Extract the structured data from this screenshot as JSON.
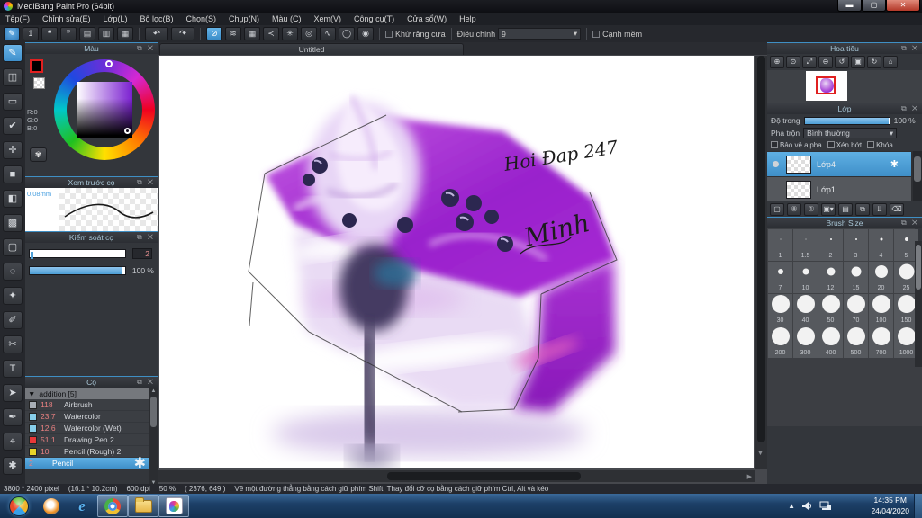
{
  "window": {
    "title": "MediBang Paint Pro (64bit)",
    "controls": [
      "minimize-icon",
      "maximize-icon",
      "close-icon"
    ]
  },
  "menubar": {
    "items": [
      "Tệp(F)",
      "Chỉnh sửa(E)",
      "Lớp(L)",
      "Bộ lọc(B)",
      "Chọn(S)",
      "Chụp(N)",
      "Màu (C)",
      "Xem(V)",
      "Công cụ(T)",
      "Cửa sổ(W)",
      "Help"
    ]
  },
  "toolbar": {
    "icons": [
      "paint-circle-icon",
      "export-icon",
      "comment-icon",
      "comment-panel-icon",
      "file-icon",
      "file-list-icon",
      "grid-icon",
      "undo-icon",
      "redo-icon",
      "snap-off-icon",
      "snap-parallel-icon",
      "snap-grid-icon",
      "snap-vanishing-icon",
      "snap-radial-icon",
      "snap-concentric-icon",
      "snap-curve-icon",
      "snap-ellipse-icon",
      "snap-spiral-icon"
    ],
    "antialias_label": "Khử răng cưa",
    "correction_label": "Điều chỉnh",
    "correction_value": "9",
    "soft_edge_label": "Cạnh mềm"
  },
  "tools": {
    "names": [
      "brush",
      "eraser",
      "frame",
      "snap-check",
      "move",
      "fill-rect",
      "bucket",
      "gradient",
      "select-rect",
      "lasso",
      "magic-wand",
      "select-pen",
      "select-eraser",
      "text",
      "operate",
      "pen",
      "eyedropper",
      "hand"
    ],
    "selected": "brush"
  },
  "panels": {
    "color": {
      "title": "Màu",
      "r": "R:0",
      "g": "G:0",
      "b": "B:0",
      "accent": "#7a1fd0"
    },
    "preview": {
      "title": "Xem trước cọ",
      "size_label": "0.08mm"
    },
    "control": {
      "title": "Kiểm soát cọ",
      "value": "2",
      "percent": "100 %"
    },
    "brushes": {
      "title": "Cọ",
      "group": "addition [5]",
      "items": [
        {
          "num": "118",
          "name": "Airbrush",
          "color": "#a8aeb6"
        },
        {
          "num": "23.7",
          "name": "Watercolor",
          "color": "#86ceea"
        },
        {
          "num": "12.6",
          "name": "Watercolor (Wet)",
          "color": "#86ceea"
        },
        {
          "num": "51.1",
          "name": "Drawing Pen 2",
          "color": "#e83838"
        },
        {
          "num": "10",
          "name": "Pencil (Rough) 2",
          "color": "#e8d428"
        }
      ],
      "selected": {
        "num": "2",
        "name": "Pencil"
      },
      "footer_icons": [
        "cloud-upload-icon",
        "new-brush-icon",
        "brush-menu-icon",
        "script-brush-icon",
        "folder-icon",
        "duplicate-icon",
        "trash-icon"
      ]
    },
    "navigator": {
      "title": "Hoa tiêu",
      "icons": [
        "zoom-in-icon",
        "zoom-icon",
        "fit-screen-icon",
        "zoom-out-icon",
        "rotate-left-icon",
        "frame-icon",
        "rotate-reset-icon",
        "lock-icon"
      ]
    },
    "layers": {
      "title": "Lớp",
      "opacity_label": "Độ trong",
      "opacity_value": "100 %",
      "blend_label": "Pha trộn",
      "blend_value": "Bình thường",
      "checkboxes": [
        "Bảo vệ alpha",
        "Xén bớt",
        "Khóa"
      ],
      "items": [
        {
          "name": "Lớp4",
          "selected": true
        },
        {
          "name": "Lớp1",
          "selected": false
        }
      ],
      "footer_icons": [
        "new-layer-icon",
        "new-8bit-layer-icon",
        "new-1bit-layer-icon",
        "add-menu-icon",
        "folder-icon",
        "duplicate-icon",
        "merge-icon",
        "trash-icon"
      ]
    },
    "brush_size": {
      "title": "Brush Size",
      "sizes": [
        "1",
        "1.5",
        "2",
        "3",
        "4",
        "5",
        "7",
        "10",
        "12",
        "15",
        "20",
        "25",
        "30",
        "40",
        "50",
        "70",
        "100",
        "150",
        "200",
        "300",
        "400",
        "500",
        "700",
        "1000"
      ]
    }
  },
  "canvas": {
    "tab": "Untitled",
    "annotation": "Hoi Đap 247",
    "signature": "Minh"
  },
  "statusbar": {
    "dimensions": "3800 * 2400 pixel",
    "size_cm": "(16.1 * 10.2cm)",
    "dpi": "600 dpi",
    "zoom": "50 %",
    "coords": "( 2376, 649 )",
    "hint": "Vẽ một đường thẳng bằng cách giữ phím Shift, Thay đổi cỡ cọ bằng cách giữ phím Ctrl, Alt và kéo"
  },
  "taskbar": {
    "icons": [
      "start-orb-icon",
      "media-player-icon",
      "internet-explorer-icon",
      "chrome-icon",
      "explorer-icon",
      "medibang-icon"
    ],
    "tray_icons": [
      "tray-expand-icon",
      "speaker-icon",
      "network-icon"
    ],
    "clock_time": "14:35 PM",
    "clock_date": "24/04/2020"
  }
}
